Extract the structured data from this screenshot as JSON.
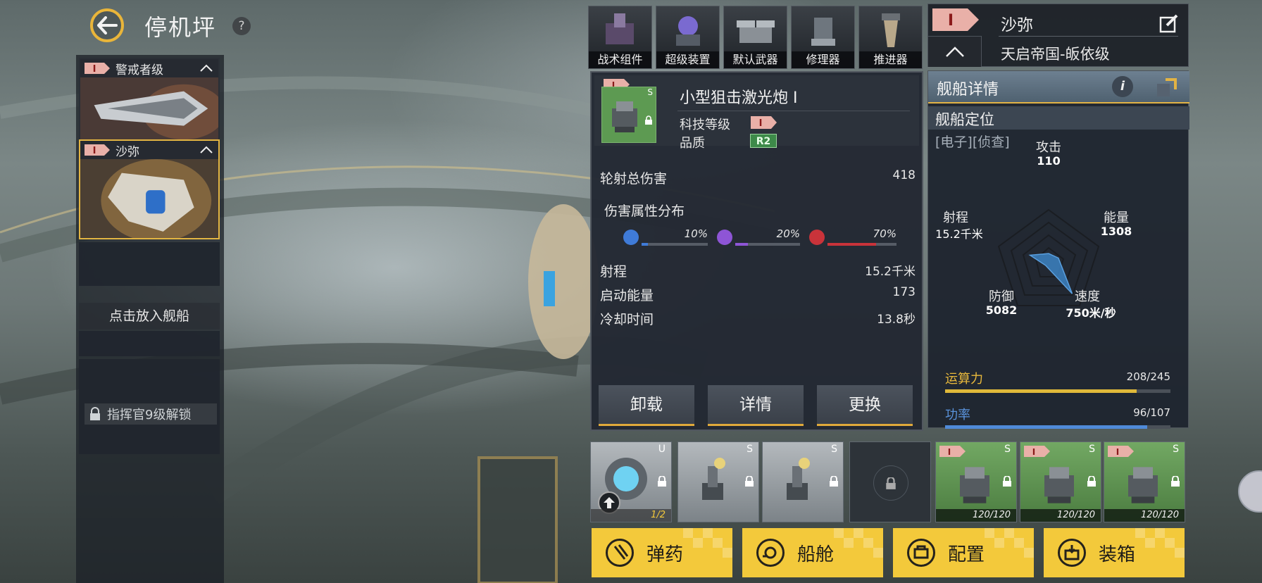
{
  "page": {
    "title": "停机坪",
    "help": "?"
  },
  "hangar": {
    "ships": [
      {
        "rank": "I",
        "name": "警戒者级",
        "selected": false
      },
      {
        "rank": "I",
        "name": "沙弥",
        "selected": true
      }
    ],
    "put_ship": "点击放入舰船",
    "unlock_tip": "指挥官9级解锁"
  },
  "equip_tabs": [
    "战术组件",
    "超级装置",
    "默认武器",
    "修理器",
    "推进器"
  ],
  "weapon": {
    "name": "小型狙击激光炮 I",
    "slot_tag": "S",
    "rank": "I",
    "tech_level_label": "科技等级",
    "quality_label": "品质",
    "quality_value": "R2",
    "stats": [
      {
        "label": "轮射总伤害",
        "value": "418"
      },
      {
        "label": "射程",
        "value": "15.2千米"
      },
      {
        "label": "启动能量",
        "value": "173"
      },
      {
        "label": "冷却时间",
        "value": "13.8秒"
      }
    ],
    "damage_dist_label": "伤害属性分布",
    "damage_dist": [
      {
        "value": "10%",
        "fraction": 0.1,
        "color": "#3f7bd8"
      },
      {
        "value": "20%",
        "fraction": 0.2,
        "color": "#8e55d6"
      },
      {
        "value": "70%",
        "fraction": 0.7,
        "color": "#c9333a"
      }
    ],
    "actions": [
      "卸载",
      "详情",
      "更换"
    ]
  },
  "ship": {
    "rank": "I",
    "name": "沙弥",
    "class": "天启帝国-皈依级"
  },
  "ship_detail": {
    "title": "舰船详情",
    "position_label": "舰船定位",
    "position_tags": "[电子][侦查]",
    "radar": [
      {
        "label": "攻击",
        "value": "110",
        "level": 0.15
      },
      {
        "label": "能量",
        "value": "1308",
        "level": 0.2
      },
      {
        "label": "速度",
        "value": "750米/秒",
        "level": 0.78
      },
      {
        "label": "防御",
        "value": "5082",
        "level": 0.1
      },
      {
        "label": "射程",
        "value": "15.2千米",
        "level": 0.38
      }
    ],
    "compute": {
      "label": "运算力",
      "value": "208/245",
      "fraction": 0.849,
      "color": "#e0b93a"
    },
    "power": {
      "label": "功率",
      "value": "96/107",
      "fraction": 0.897,
      "color": "#4f8ad8"
    }
  },
  "slots": [
    {
      "type": "U",
      "style": "gray",
      "count": "1/2"
    },
    {
      "type": "S",
      "style": "gray",
      "count": ""
    },
    {
      "type": "S",
      "style": "gray",
      "count": ""
    },
    {
      "type": "",
      "style": "dark",
      "count": ""
    },
    {
      "type": "S",
      "style": "green",
      "count": "120/120"
    },
    {
      "type": "S",
      "style": "green",
      "count": "120/120"
    },
    {
      "type": "S",
      "style": "green",
      "count": "120/120"
    }
  ],
  "bottom_buttons": [
    "弹药",
    "船舱",
    "配置",
    "装箱"
  ]
}
